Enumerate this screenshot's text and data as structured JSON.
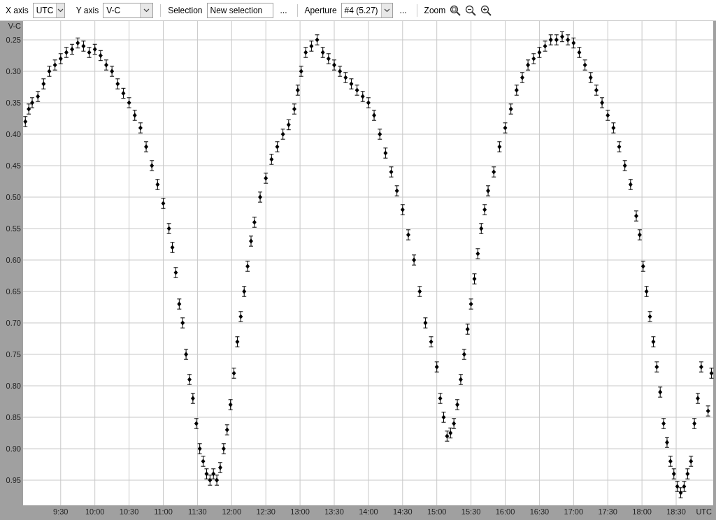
{
  "toolbar": {
    "x_axis": {
      "label": "X axis",
      "value": "UTC"
    },
    "y_axis": {
      "label": "Y axis",
      "value": "V-C"
    },
    "selection": {
      "label": "Selection",
      "value": "New selection",
      "more": "..."
    },
    "aperture": {
      "label": "Aperture",
      "value": "#4 (5.27)",
      "more": "..."
    },
    "zoom": {
      "label": "Zoom"
    }
  },
  "chart": {
    "chart_data": {
      "type": "scatter",
      "grid": true,
      "ylabel": "V-C",
      "xlabel": "UTC",
      "xlim": [
        537,
        1142.5
      ],
      "ylim": [
        0.99,
        0.22
      ],
      "xticks": [
        {
          "value": 570,
          "label": "9:30"
        },
        {
          "value": 600,
          "label": "10:00"
        },
        {
          "value": 630,
          "label": "10:30"
        },
        {
          "value": 660,
          "label": "11:00"
        },
        {
          "value": 690,
          "label": "11:30"
        },
        {
          "value": 720,
          "label": "12:00"
        },
        {
          "value": 750,
          "label": "12:30"
        },
        {
          "value": 780,
          "label": "13:00"
        },
        {
          "value": 810,
          "label": "13:30"
        },
        {
          "value": 840,
          "label": "14:00"
        },
        {
          "value": 870,
          "label": "14:30"
        },
        {
          "value": 900,
          "label": "15:00"
        },
        {
          "value": 930,
          "label": "15:30"
        },
        {
          "value": 960,
          "label": "16:00"
        },
        {
          "value": 990,
          "label": "16:30"
        },
        {
          "value": 1020,
          "label": "17:00"
        },
        {
          "value": 1050,
          "label": "17:30"
        },
        {
          "value": 1080,
          "label": "18:00"
        },
        {
          "value": 1110,
          "label": "18:30"
        }
      ],
      "yticks": [
        {
          "value": 0.25,
          "label": "0.25"
        },
        {
          "value": 0.3,
          "label": "0.30"
        },
        {
          "value": 0.35,
          "label": "0.35"
        },
        {
          "value": 0.4,
          "label": "0.40"
        },
        {
          "value": 0.45,
          "label": "0.45"
        },
        {
          "value": 0.5,
          "label": "0.50"
        },
        {
          "value": 0.55,
          "label": "0.55"
        },
        {
          "value": 0.6,
          "label": "0.60"
        },
        {
          "value": 0.65,
          "label": "0.65"
        },
        {
          "value": 0.7,
          "label": "0.70"
        },
        {
          "value": 0.75,
          "label": "0.75"
        },
        {
          "value": 0.8,
          "label": "0.80"
        },
        {
          "value": 0.85,
          "label": "0.85"
        },
        {
          "value": 0.9,
          "label": "0.90"
        },
        {
          "value": 0.95,
          "label": "0.95"
        }
      ],
      "x": [
        539,
        542,
        545,
        550,
        555,
        560,
        565,
        570,
        575,
        580,
        585,
        590,
        595,
        600,
        605,
        610,
        615,
        620,
        625,
        630,
        635,
        640,
        645,
        650,
        655,
        660,
        665,
        668,
        671,
        674,
        677,
        680,
        683,
        686,
        689,
        692,
        695,
        698,
        701,
        704,
        707,
        710,
        713,
        716,
        719,
        722,
        725,
        728,
        731,
        734,
        737,
        740,
        745,
        750,
        755,
        760,
        765,
        770,
        775,
        778,
        781,
        785,
        790,
        795,
        800,
        805,
        810,
        815,
        820,
        825,
        830,
        835,
        840,
        845,
        850,
        855,
        860,
        865,
        870,
        875,
        880,
        885,
        890,
        895,
        900,
        903,
        906,
        909,
        912,
        915,
        918,
        921,
        924,
        927,
        930,
        933,
        936,
        939,
        942,
        945,
        950,
        955,
        960,
        965,
        970,
        975,
        980,
        985,
        990,
        995,
        1000,
        1005,
        1010,
        1015,
        1020,
        1025,
        1030,
        1035,
        1040,
        1045,
        1050,
        1055,
        1060,
        1065,
        1070,
        1075,
        1078,
        1081,
        1084,
        1087,
        1090,
        1093,
        1096,
        1099,
        1102,
        1105,
        1108,
        1111,
        1114,
        1117,
        1120,
        1123,
        1126,
        1129,
        1132,
        1138,
        1141
      ],
      "series": [
        {
          "color": "#000000",
          "errors": [
            0.008,
            0.008,
            0.008,
            0.008,
            0.008,
            0.008,
            0.008,
            0.008,
            0.008,
            0.008,
            0.008,
            0.008,
            0.008,
            0.008,
            0.008,
            0.008,
            0.008,
            0.008,
            0.008,
            0.008,
            0.008,
            0.008,
            0.008,
            0.008,
            0.008,
            0.008,
            0.008,
            0.008,
            0.008,
            0.008,
            0.008,
            0.008,
            0.008,
            0.008,
            0.008,
            0.008,
            0.008,
            0.008,
            0.008,
            0.008,
            0.008,
            0.008,
            0.008,
            0.008,
            0.008,
            0.008,
            0.008,
            0.008,
            0.008,
            0.008,
            0.008,
            0.008,
            0.008,
            0.008,
            0.008,
            0.008,
            0.008,
            0.008,
            0.008,
            0.008,
            0.008,
            0.008,
            0.008,
            0.008,
            0.008,
            0.008,
            0.008,
            0.008,
            0.008,
            0.008,
            0.008,
            0.008,
            0.008,
            0.008,
            0.008,
            0.008,
            0.008,
            0.008,
            0.008,
            0.008,
            0.008,
            0.008,
            0.008,
            0.008,
            0.008,
            0.008,
            0.008,
            0.008,
            0.008,
            0.008,
            0.008,
            0.008,
            0.008,
            0.008,
            0.008,
            0.008,
            0.008,
            0.008,
            0.008,
            0.008,
            0.008,
            0.008,
            0.008,
            0.008,
            0.008,
            0.008,
            0.008,
            0.008,
            0.008,
            0.008,
            0.008,
            0.008,
            0.008,
            0.008,
            0.008,
            0.008,
            0.008,
            0.008,
            0.008,
            0.008,
            0.008,
            0.008,
            0.008,
            0.008,
            0.008,
            0.008,
            0.008,
            0.008,
            0.008,
            0.008,
            0.008,
            0.008,
            0.008,
            0.008,
            0.008,
            0.008,
            0.008,
            0.008,
            0.008,
            0.008,
            0.008,
            0.008,
            0.008,
            0.008,
            0.008,
            0.008,
            0.008
          ],
          "values": [
            0.38,
            0.36,
            0.35,
            0.34,
            0.32,
            0.3,
            0.29,
            0.28,
            0.27,
            0.265,
            0.255,
            0.26,
            0.27,
            0.265,
            0.275,
            0.29,
            0.3,
            0.32,
            0.335,
            0.35,
            0.37,
            0.39,
            0.42,
            0.45,
            0.48,
            0.51,
            0.55,
            0.58,
            0.62,
            0.67,
            0.7,
            0.75,
            0.79,
            0.82,
            0.86,
            0.9,
            0.92,
            0.94,
            0.95,
            0.94,
            0.95,
            0.93,
            0.9,
            0.87,
            0.83,
            0.78,
            0.73,
            0.69,
            0.65,
            0.61,
            0.57,
            0.54,
            0.5,
            0.47,
            0.44,
            0.42,
            0.4,
            0.385,
            0.36,
            0.33,
            0.3,
            0.27,
            0.26,
            0.25,
            0.27,
            0.28,
            0.29,
            0.3,
            0.31,
            0.32,
            0.33,
            0.34,
            0.35,
            0.37,
            0.4,
            0.43,
            0.46,
            0.49,
            0.52,
            0.56,
            0.6,
            0.65,
            0.7,
            0.73,
            0.77,
            0.82,
            0.85,
            0.88,
            0.875,
            0.86,
            0.83,
            0.79,
            0.75,
            0.71,
            0.67,
            0.63,
            0.59,
            0.55,
            0.52,
            0.49,
            0.46,
            0.42,
            0.39,
            0.36,
            0.33,
            0.31,
            0.29,
            0.28,
            0.27,
            0.26,
            0.25,
            0.25,
            0.245,
            0.25,
            0.255,
            0.27,
            0.29,
            0.31,
            0.33,
            0.35,
            0.37,
            0.39,
            0.42,
            0.45,
            0.48,
            0.53,
            0.56,
            0.61,
            0.65,
            0.69,
            0.73,
            0.77,
            0.81,
            0.86,
            0.89,
            0.92,
            0.94,
            0.96,
            0.97,
            0.96,
            0.94,
            0.92,
            0.86,
            0.82,
            0.77,
            0.84,
            0.78
          ]
        }
      ]
    }
  }
}
